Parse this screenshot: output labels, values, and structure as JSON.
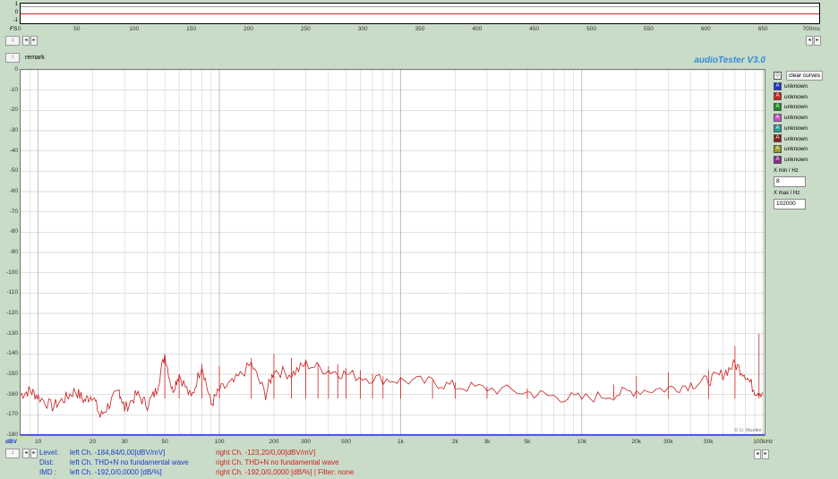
{
  "scope": {
    "y_ticks": [
      "1",
      "0",
      "-1"
    ],
    "fs_label": "FS",
    "x_ticks": [
      "0",
      "50",
      "100",
      "150",
      "200",
      "250",
      "300",
      "350",
      "400",
      "450",
      "500",
      "550",
      "600",
      "650",
      "700ms"
    ],
    "x_vals": [
      0,
      50,
      100,
      150,
      200,
      250,
      300,
      350,
      400,
      450,
      500,
      550,
      600,
      650,
      700
    ]
  },
  "header": {
    "remark": "remark",
    "app_title": "audioTester  V3.0"
  },
  "legend": {
    "clear_label": "clear curves",
    "items": [
      {
        "label": "unknown",
        "color": "#1f2fd0"
      },
      {
        "label": "unknown",
        "color": "#d21f1f"
      },
      {
        "label": "unknown",
        "color": "#1f8a1f"
      },
      {
        "label": "unknown",
        "color": "#c84fc8"
      },
      {
        "label": "unknown",
        "color": "#2a9a9a"
      },
      {
        "label": "unknown",
        "color": "#8a1f1f"
      },
      {
        "label": "unknown",
        "color": "#9a9a1f"
      },
      {
        "label": "unknown",
        "color": "#8a2a8a"
      }
    ],
    "item_glyph": "A",
    "xmin_label": "X min / Hz",
    "xmin_value": "8",
    "xmax_label": "X max / Hz",
    "xmax_value": "102000"
  },
  "chart_data": {
    "type": "line",
    "ylabel": "dBV",
    "ylim": [
      -180,
      0
    ],
    "y_ticks": [
      0,
      -10,
      -20,
      -30,
      -40,
      -50,
      -60,
      -70,
      -80,
      -90,
      -100,
      -110,
      -120,
      -130,
      -140,
      -150,
      -160,
      -170,
      -180
    ],
    "y_tick_labels": [
      "0",
      "-10",
      "-20",
      "-30",
      "-40",
      "-50",
      "-60",
      "-70",
      "-80",
      "-90",
      "-100",
      "-110",
      "-120",
      "-130",
      "-140",
      "-150",
      "-160",
      "-170",
      "-180"
    ],
    "xlim": [
      8,
      102000
    ],
    "x_scale": "log",
    "x_ticks": [
      10,
      20,
      30,
      50,
      100,
      200,
      300,
      500,
      1000,
      2000,
      3000,
      5000,
      10000,
      20000,
      30000,
      50000,
      100000
    ],
    "x_tick_labels": [
      "10",
      "20",
      "30",
      "50",
      "100",
      "200",
      "300",
      "500",
      "1k",
      "2k",
      "3k",
      "5k",
      "10k",
      "20k",
      "30k",
      "50k",
      "100kHz"
    ],
    "grid": true,
    "series": [
      {
        "color": "#c81e1e",
        "points": [
          [
            8,
            -160
          ],
          [
            9,
            -158
          ],
          [
            10,
            -161
          ],
          [
            12,
            -166
          ],
          [
            14,
            -162
          ],
          [
            16,
            -158
          ],
          [
            18,
            -163
          ],
          [
            20,
            -160
          ],
          [
            22,
            -171
          ],
          [
            25,
            -164
          ],
          [
            28,
            -158
          ],
          [
            30,
            -167
          ],
          [
            35,
            -160
          ],
          [
            40,
            -165
          ],
          [
            45,
            -158
          ],
          [
            50,
            -140
          ],
          [
            55,
            -158
          ],
          [
            60,
            -150
          ],
          [
            70,
            -162
          ],
          [
            80,
            -145
          ],
          [
            90,
            -165
          ],
          [
            100,
            -158
          ],
          [
            120,
            -154
          ],
          [
            150,
            -145
          ],
          [
            180,
            -160
          ],
          [
            200,
            -148
          ],
          [
            250,
            -150
          ],
          [
            300,
            -145
          ],
          [
            400,
            -148
          ],
          [
            500,
            -150
          ],
          [
            700,
            -152
          ],
          [
            1000,
            -153
          ],
          [
            1500,
            -154
          ],
          [
            2000,
            -156
          ],
          [
            3000,
            -157
          ],
          [
            5000,
            -159
          ],
          [
            7000,
            -161
          ],
          [
            10000,
            -162
          ],
          [
            15000,
            -160
          ],
          [
            20000,
            -158
          ],
          [
            30000,
            -157
          ],
          [
            40000,
            -155
          ],
          [
            50000,
            -153
          ],
          [
            60000,
            -150
          ],
          [
            70000,
            -145
          ],
          [
            80000,
            -150
          ],
          [
            90000,
            -158
          ],
          [
            100000,
            -159
          ]
        ]
      },
      {
        "color": "#d02020",
        "spikes": [
          [
            50,
            -140
          ],
          [
            60,
            -150
          ],
          [
            80,
            -145
          ],
          [
            100,
            -146
          ],
          [
            150,
            -142
          ],
          [
            200,
            -140
          ],
          [
            250,
            -142
          ],
          [
            300,
            -144
          ],
          [
            350,
            -145
          ],
          [
            400,
            -146
          ],
          [
            450,
            -145
          ],
          [
            500,
            -147
          ],
          [
            600,
            -148
          ],
          [
            700,
            -150
          ],
          [
            800,
            -151
          ],
          [
            1000,
            -152
          ],
          [
            1500,
            -153
          ],
          [
            2000,
            -154
          ],
          [
            3000,
            -156
          ],
          [
            5000,
            -157
          ],
          [
            15000,
            -155
          ],
          [
            20000,
            -151
          ],
          [
            30000,
            -149
          ],
          [
            50000,
            -148
          ],
          [
            70000,
            -136
          ],
          [
            95000,
            -130
          ]
        ]
      }
    ],
    "watermark": "© U. Mueller"
  },
  "status": {
    "level_label": "Level:",
    "dist_label": "Dist:",
    "imd_label": "IMD  :",
    "level_left": "left Ch. -184,84/0,00[dBV/mV]",
    "level_right": "right Ch. -123,20/0,00[dBV/mV]",
    "dist_left": "left Ch. THD+N  no fundamental wave",
    "dist_right": "right Ch. THD+N  no fundamental wave",
    "imd_left": "left Ch. -192,0/0,0000 [dB/%]",
    "imd_right": "right Ch. -192,0/0,0000 [dB/%] |   Filter: none"
  },
  "controls": {
    "spin_glyph": "↕",
    "left_arrow": "◂",
    "right_arrow": "▸",
    "clear_glyph": "◇"
  }
}
